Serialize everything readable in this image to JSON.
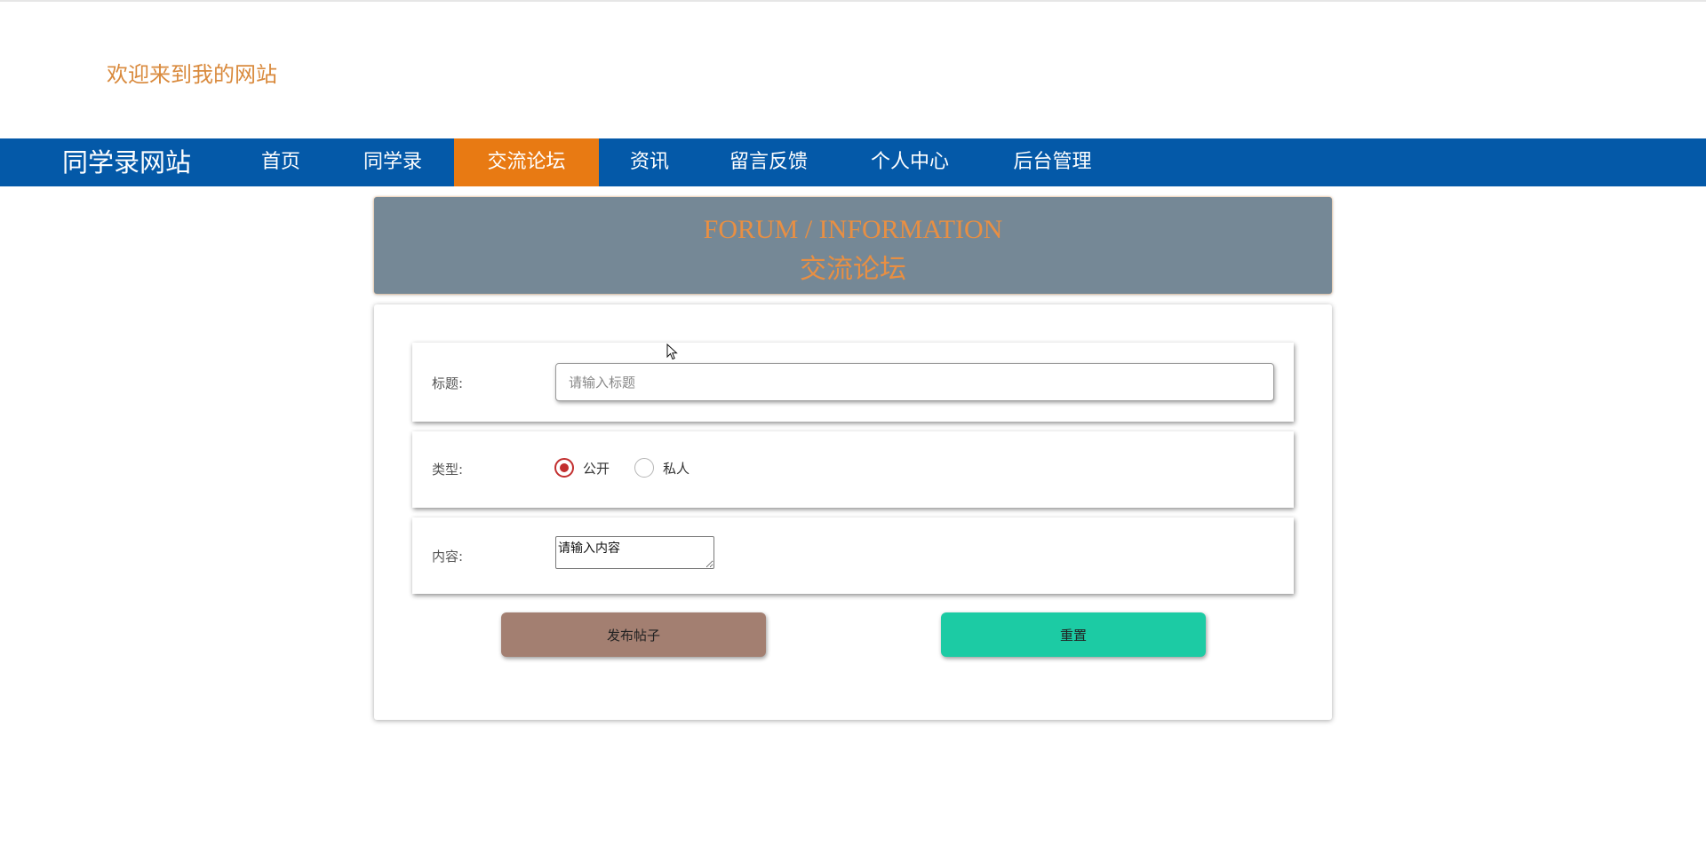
{
  "header": {
    "welcome": "欢迎来到我的网站"
  },
  "nav": {
    "brand": "同学录网站",
    "items": [
      {
        "label": "首页",
        "active": false
      },
      {
        "label": "同学录",
        "active": false
      },
      {
        "label": "交流论坛",
        "active": true
      },
      {
        "label": "资讯",
        "active": false
      },
      {
        "label": "留言反馈",
        "active": false
      },
      {
        "label": "个人中心",
        "active": false
      },
      {
        "label": "后台管理",
        "active": false
      }
    ]
  },
  "banner": {
    "title_en": "FORUM / INFORMATION",
    "title_cn": "交流论坛"
  },
  "form": {
    "title_label": "标题:",
    "title_placeholder": "请输入标题",
    "type_label": "类型:",
    "type_options": [
      {
        "label": "公开",
        "checked": true
      },
      {
        "label": "私人",
        "checked": false
      }
    ],
    "content_label": "内容:",
    "content_placeholder": "请输入内容",
    "publish_button": "发布帖子",
    "reset_button": "重置"
  },
  "colors": {
    "nav_bg": "#0459a8",
    "nav_active": "#e87a13",
    "accent_orange": "#d98a3d",
    "banner_bg": "#758896",
    "publish_bg": "#a37f71",
    "reset_bg": "#1ccba4",
    "radio_checked": "#c22e2e"
  }
}
